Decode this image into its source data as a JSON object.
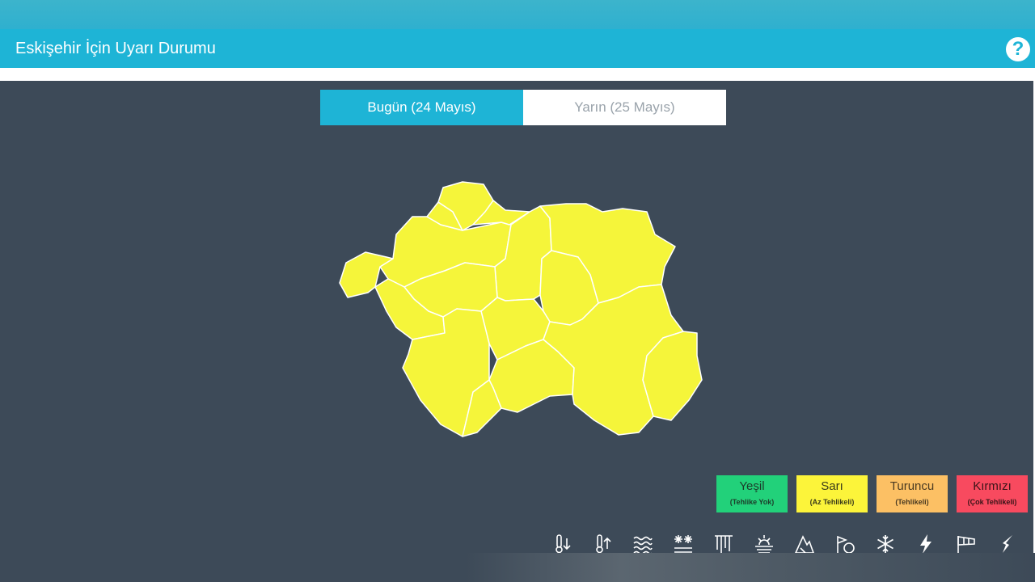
{
  "header": {
    "title": "Eskişehir İçin Uyarı Durumu",
    "help_glyph": "?"
  },
  "tabs": [
    {
      "label": "Bugün (24 Mayıs)",
      "active": true
    },
    {
      "label": "Yarın (25 Mayıs)",
      "active": false
    }
  ],
  "map": {
    "region": "Eskişehir",
    "warning_level": "Sarı",
    "fill": "#f5f53a",
    "stroke": "#ffffff"
  },
  "legend": [
    {
      "title": "Yeşil",
      "subtitle": "(Tehlike Yok)",
      "bg": "#22d17a",
      "color": "#1d3b2a"
    },
    {
      "title": "Sarı",
      "subtitle": "(Az Tehlikeli)",
      "bg": "#fcf43a",
      "color": "#3a3a1a"
    },
    {
      "title": "Turuncu",
      "subtitle": "(Tehlikeli)",
      "bg": "#fcc064",
      "color": "#4a3a22"
    },
    {
      "title": "Kırmızı",
      "subtitle": "(Çok Tehlikeli)",
      "bg": "#f84a5f",
      "color": "#3a1418"
    }
  ],
  "hazard_icons": [
    "low-temperature-icon",
    "high-temperature-icon",
    "fog-icon",
    "snow-ice-icon",
    "rain-icon",
    "thunder-snow-icon",
    "avalanche-icon",
    "flood-icon",
    "snowflake-icon",
    "lightning-icon",
    "wind-icon",
    "hail-icon"
  ]
}
